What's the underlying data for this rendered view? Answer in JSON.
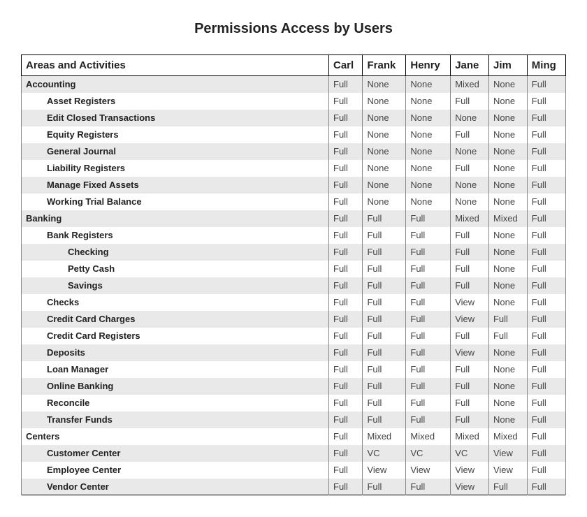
{
  "title": "Permissions Access by Users",
  "header_activity": "Areas and Activities",
  "users": [
    "Carl",
    "Frank",
    "Henry",
    "Jane",
    "Jim",
    "Ming"
  ],
  "rows": [
    {
      "label": "Accounting",
      "indent": 0,
      "perms": [
        "Full",
        "None",
        "None",
        "Mixed",
        "None",
        "Full"
      ]
    },
    {
      "label": "Asset Registers",
      "indent": 1,
      "perms": [
        "Full",
        "None",
        "None",
        "Full",
        "None",
        "Full"
      ]
    },
    {
      "label": "Edit Closed Transactions",
      "indent": 1,
      "perms": [
        "Full",
        "None",
        "None",
        "None",
        "None",
        "Full"
      ]
    },
    {
      "label": "Equity Registers",
      "indent": 1,
      "perms": [
        "Full",
        "None",
        "None",
        "Full",
        "None",
        "Full"
      ]
    },
    {
      "label": "General Journal",
      "indent": 1,
      "perms": [
        "Full",
        "None",
        "None",
        "None",
        "None",
        "Full"
      ]
    },
    {
      "label": "Liability Registers",
      "indent": 1,
      "perms": [
        "Full",
        "None",
        "None",
        "Full",
        "None",
        "Full"
      ]
    },
    {
      "label": "Manage Fixed Assets",
      "indent": 1,
      "perms": [
        "Full",
        "None",
        "None",
        "None",
        "None",
        "Full"
      ]
    },
    {
      "label": "Working Trial Balance",
      "indent": 1,
      "perms": [
        "Full",
        "None",
        "None",
        "None",
        "None",
        "Full"
      ]
    },
    {
      "label": "Banking",
      "indent": 0,
      "perms": [
        "Full",
        "Full",
        "Full",
        "Mixed",
        "Mixed",
        "Full"
      ]
    },
    {
      "label": "Bank Registers",
      "indent": 1,
      "perms": [
        "Full",
        "Full",
        "Full",
        "Full",
        "None",
        "Full"
      ]
    },
    {
      "label": "Checking",
      "indent": 2,
      "perms": [
        "Full",
        "Full",
        "Full",
        "Full",
        "None",
        "Full"
      ]
    },
    {
      "label": "Petty Cash",
      "indent": 2,
      "perms": [
        "Full",
        "Full",
        "Full",
        "Full",
        "None",
        "Full"
      ]
    },
    {
      "label": "Savings",
      "indent": 2,
      "perms": [
        "Full",
        "Full",
        "Full",
        "Full",
        "None",
        "Full"
      ]
    },
    {
      "label": "Checks",
      "indent": 1,
      "perms": [
        "Full",
        "Full",
        "Full",
        "View",
        "None",
        "Full"
      ]
    },
    {
      "label": "Credit Card Charges",
      "indent": 1,
      "perms": [
        "Full",
        "Full",
        "Full",
        "View",
        "Full",
        "Full"
      ]
    },
    {
      "label": "Credit Card Registers",
      "indent": 1,
      "perms": [
        "Full",
        "Full",
        "Full",
        "Full",
        "Full",
        "Full"
      ]
    },
    {
      "label": "Deposits",
      "indent": 1,
      "perms": [
        "Full",
        "Full",
        "Full",
        "View",
        "None",
        "Full"
      ]
    },
    {
      "label": "Loan Manager",
      "indent": 1,
      "perms": [
        "Full",
        "Full",
        "Full",
        "Full",
        "None",
        "Full"
      ]
    },
    {
      "label": "Online Banking",
      "indent": 1,
      "perms": [
        "Full",
        "Full",
        "Full",
        "Full",
        "None",
        "Full"
      ]
    },
    {
      "label": "Reconcile",
      "indent": 1,
      "perms": [
        "Full",
        "Full",
        "Full",
        "Full",
        "None",
        "Full"
      ]
    },
    {
      "label": "Transfer Funds",
      "indent": 1,
      "perms": [
        "Full",
        "Full",
        "Full",
        "Full",
        "None",
        "Full"
      ]
    },
    {
      "label": "Centers",
      "indent": 0,
      "perms": [
        "Full",
        "Mixed",
        "Mixed",
        "Mixed",
        "Mixed",
        "Full"
      ]
    },
    {
      "label": "Customer Center",
      "indent": 1,
      "perms": [
        "Full",
        "VC",
        "VC",
        "VC",
        "View",
        "Full"
      ]
    },
    {
      "label": "Employee Center",
      "indent": 1,
      "perms": [
        "Full",
        "View",
        "View",
        "View",
        "View",
        "Full"
      ]
    },
    {
      "label": "Vendor Center",
      "indent": 1,
      "perms": [
        "Full",
        "Full",
        "Full",
        "View",
        "Full",
        "Full"
      ]
    }
  ]
}
